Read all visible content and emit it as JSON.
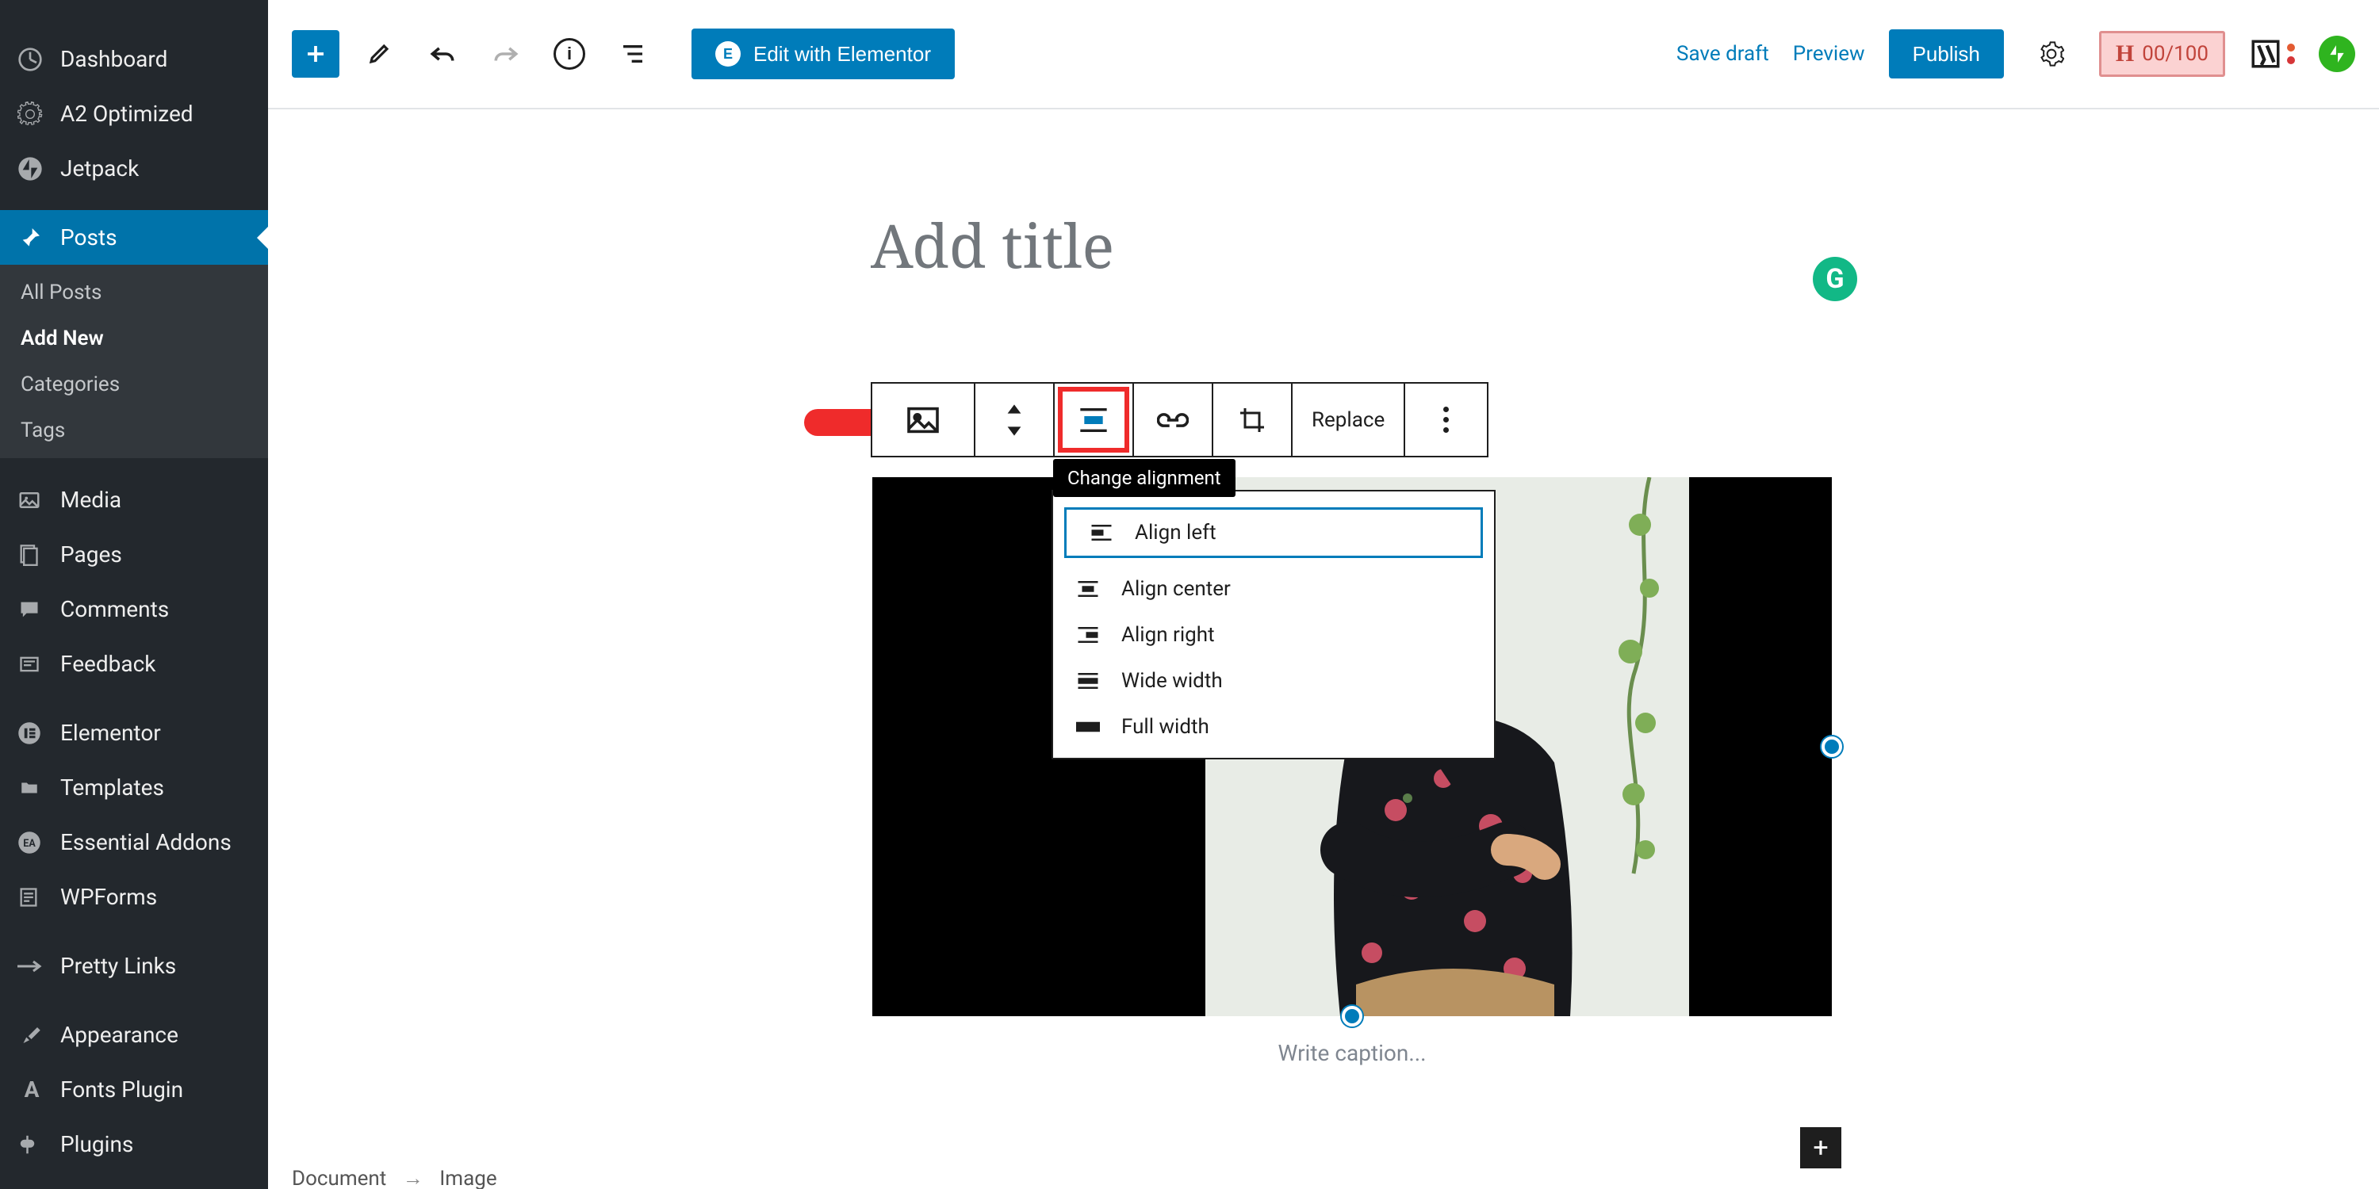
{
  "sidebar": {
    "items": [
      {
        "label": "Dashboard"
      },
      {
        "label": "A2 Optimized"
      },
      {
        "label": "Jetpack"
      },
      {
        "label": "Posts"
      },
      {
        "label": "Media"
      },
      {
        "label": "Pages"
      },
      {
        "label": "Comments"
      },
      {
        "label": "Feedback"
      },
      {
        "label": "Elementor"
      },
      {
        "label": "Templates"
      },
      {
        "label": "Essential Addons"
      },
      {
        "label": "WPForms"
      },
      {
        "label": "Pretty Links"
      },
      {
        "label": "Appearance"
      },
      {
        "label": "Fonts Plugin"
      },
      {
        "label": "Plugins"
      }
    ],
    "posts_submenu": [
      {
        "label": "All Posts"
      },
      {
        "label": "Add New"
      },
      {
        "label": "Categories"
      },
      {
        "label": "Tags"
      }
    ]
  },
  "topbar": {
    "elementor_label": "Edit with Elementor",
    "save_draft": "Save draft",
    "preview": "Preview",
    "publish": "Publish",
    "score": "00/100"
  },
  "editor": {
    "title_placeholder": "Add title",
    "caption_placeholder": "Write caption...",
    "breadcrumb": {
      "a": "Document",
      "b": "Image"
    }
  },
  "block_toolbar": {
    "replace": "Replace",
    "tooltip": "Change alignment",
    "options": [
      {
        "label": "Align left"
      },
      {
        "label": "Align center"
      },
      {
        "label": "Align right"
      },
      {
        "label": "Wide width"
      },
      {
        "label": "Full width"
      }
    ]
  }
}
